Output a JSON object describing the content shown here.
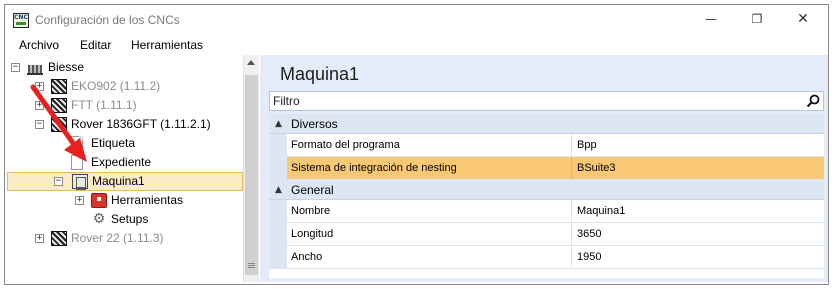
{
  "window": {
    "title": "Configuración de los CNCs",
    "app_icon_text": "CNC",
    "controls": {
      "minimize": "—",
      "maximize": "❐",
      "close": "✕"
    }
  },
  "menu": [
    "Archivo",
    "Editar",
    "Herramientas"
  ],
  "tree": {
    "root": {
      "label": "Biesse",
      "expander": "−"
    },
    "machines": [
      {
        "label": "EKO902 (1.11.2)",
        "expander": "+"
      },
      {
        "label": "FTT (1.11.1)",
        "expander": "+"
      },
      {
        "label": "Rover 1836GFT (1.11.2.1)",
        "expander": "−"
      }
    ],
    "children": [
      {
        "label": "Etiqueta"
      },
      {
        "label": "Expediente"
      }
    ],
    "selected": {
      "label": "Maquina1",
      "expander": "−"
    },
    "sub_children": [
      {
        "label": "Herramientas",
        "expander": "+"
      },
      {
        "label": "Setups"
      }
    ],
    "last": {
      "label": "Rover 22 (1.11.3)",
      "expander": "+"
    }
  },
  "details": {
    "heading": "Maquina1",
    "filter_placeholder": "Filtro",
    "categories": [
      {
        "name": "Diversos",
        "rows": [
          {
            "name": "Formato del programa",
            "value": "Bpp"
          },
          {
            "name": "Sistema de integración de  nesting",
            "value": "BSuite3",
            "highlighted": true
          }
        ]
      },
      {
        "name": "General",
        "rows": [
          {
            "name": "Nombre",
            "value": "Maquina1"
          },
          {
            "name": "Longitud",
            "value": "3650"
          },
          {
            "name": "Ancho",
            "value": "1950"
          }
        ]
      }
    ]
  },
  "colors": {
    "selection_row": "#f8c874",
    "tree_selection": "#fcecc6",
    "panel_background": "#e3ecf8",
    "annotation_arrow": "#e8201e"
  }
}
